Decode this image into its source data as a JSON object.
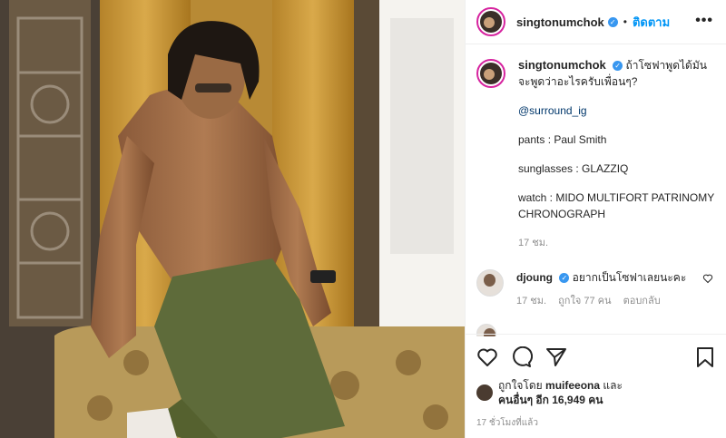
{
  "post": {
    "username": "singtonumchok",
    "follow_label": "ติดตาม",
    "more_label": "•••",
    "verified_mark": "✓",
    "caption": {
      "username": "singtonumchok",
      "text": "ถ้าโซฟาพูดได้มันจะพูดว่าอะไรครับเพื่อนๆ?",
      "mention": "@surround_ig",
      "pants": "pants : Paul Smith",
      "sunglasses": "sunglasses : GLAZZIQ",
      "watch": "watch : MIDO MULTIFORT PATRINOMY CHRONOGRAPH",
      "time": "17 ชม."
    },
    "comments": [
      {
        "username": "djoung",
        "text": "อยากเป็นโซฟาเลยนะคะ",
        "time": "17 ชม.",
        "likes": "ถูกใจ 77 คน",
        "reply": "ตอบกลับ"
      }
    ],
    "liked_by_prefix": "ถูกใจโดย",
    "liked_by_user": "muifeeona",
    "liked_by_and": "และ",
    "liked_by_others": "คนอื่นๆ อีก 16,949 คน",
    "posted_ago": "17 ชั่วโมงที่แล้ว"
  },
  "icons": {
    "like": "heart-icon",
    "comment": "comment-icon",
    "share": "share-icon",
    "save": "bookmark-icon"
  },
  "colors": {
    "accent": "#0095f6",
    "verified": "#3897f0",
    "muted": "#8e8e8e"
  }
}
